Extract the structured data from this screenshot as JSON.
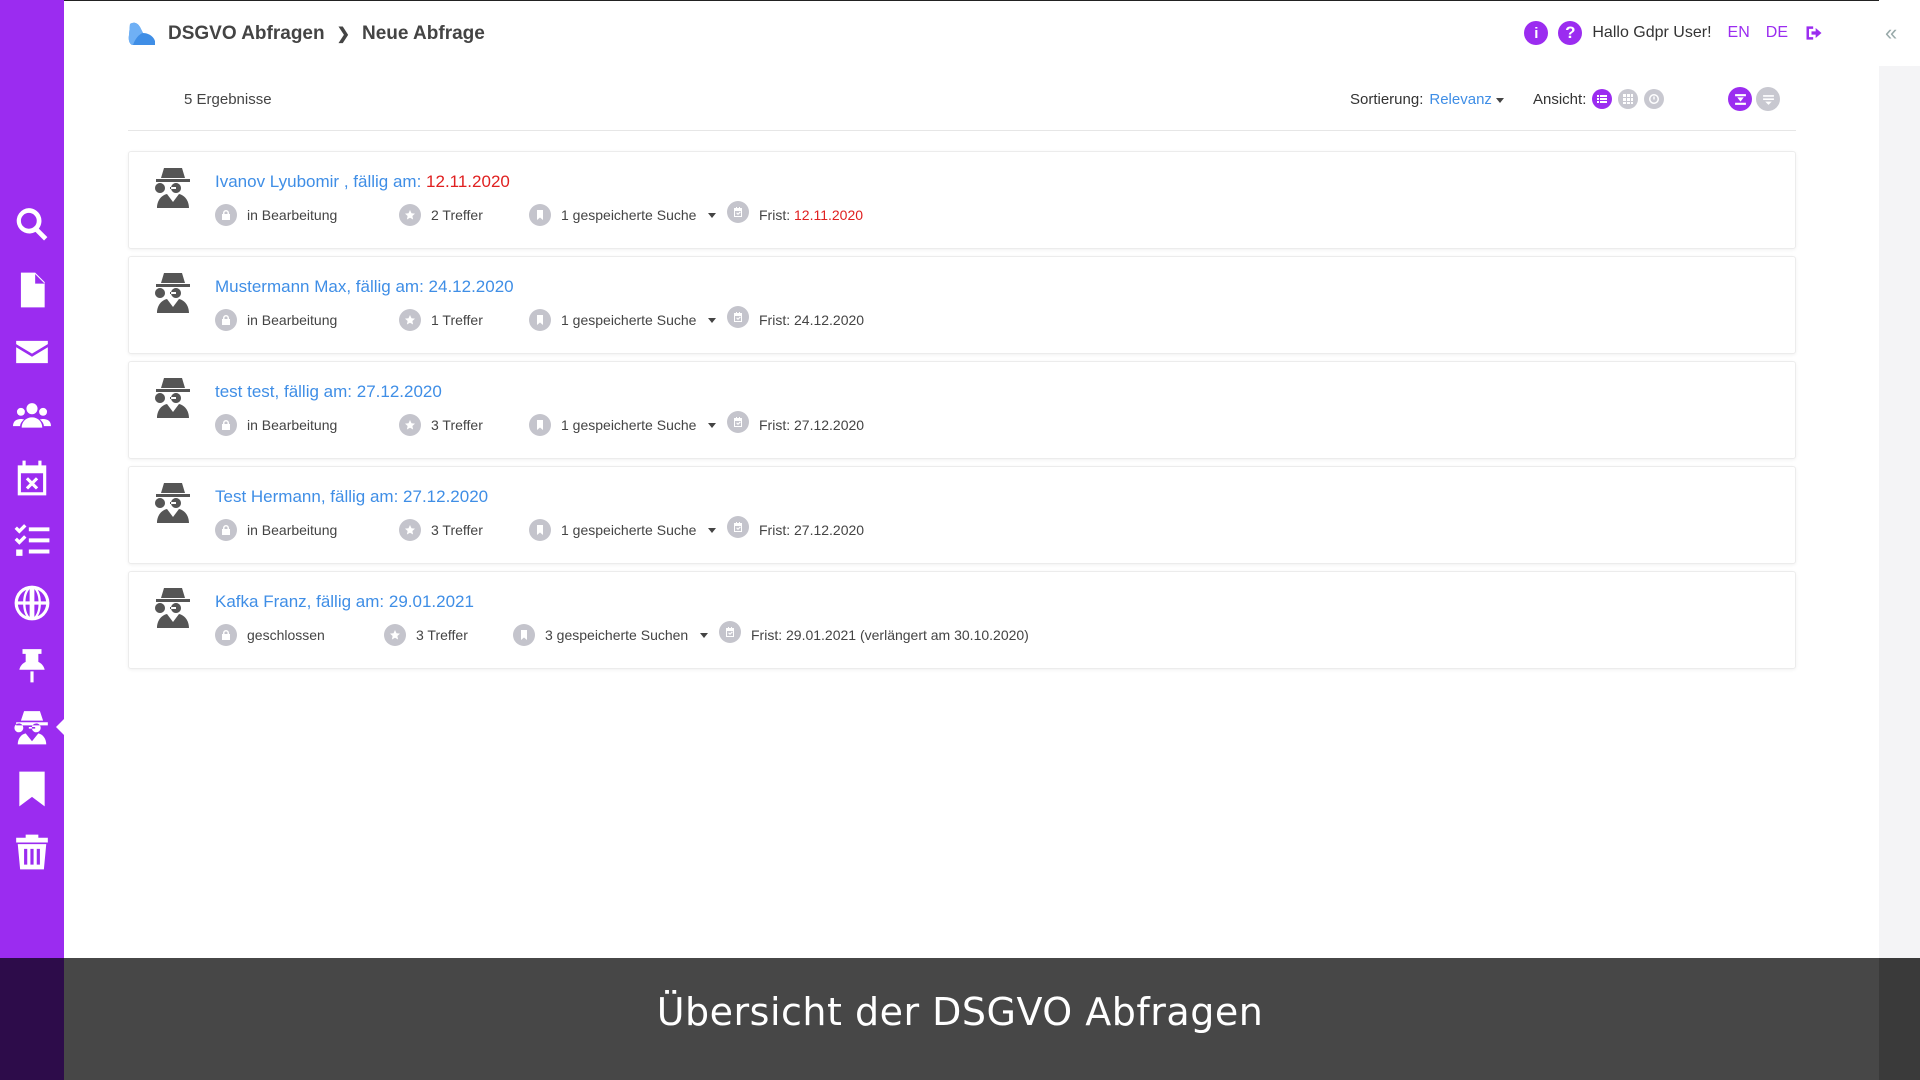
{
  "header": {
    "breadcrumb": [
      "DSGVO Abfragen",
      "Neue Abfrage"
    ],
    "info_icon": "info-icon",
    "help_icon": "help-icon",
    "greeting": "Hallo Gdpr User!",
    "lang_en": "EN",
    "lang_de": "DE",
    "logout_icon": "logout-icon",
    "collapse_icon": "«"
  },
  "sidebar": {
    "items": [
      {
        "icon": "search-icon"
      },
      {
        "icon": "document-icon"
      },
      {
        "icon": "mail-icon"
      },
      {
        "icon": "users-icon"
      },
      {
        "icon": "calendar-x-icon"
      },
      {
        "icon": "checklist-icon"
      },
      {
        "icon": "globe-icon"
      },
      {
        "icon": "pin-icon"
      },
      {
        "icon": "spy-icon",
        "active": true
      },
      {
        "icon": "bookmark-icon"
      },
      {
        "icon": "trash-icon"
      }
    ]
  },
  "toolbar": {
    "results_count": "5 Ergebnisse",
    "sort_label": "Sortierung:",
    "sort_value": "Relevanz",
    "view_label": "Ansicht:"
  },
  "requests": [
    {
      "title": "Ivanov Lyubomir , fällig am:",
      "due": "12.11.2020",
      "due_overdue": true,
      "status": "in Bearbeitung",
      "hits": "2 Treffer",
      "saved": "1 gespeicherte Suche",
      "deadline_label": "Frist:",
      "deadline": "12.11.2020",
      "deadline_extra": ""
    },
    {
      "title": "Mustermann Max, fällig am:",
      "due": "24.12.2020",
      "due_overdue": false,
      "status": "in Bearbeitung",
      "hits": "1 Treffer",
      "saved": "1 gespeicherte Suche",
      "deadline_label": "Frist:",
      "deadline": "24.12.2020",
      "deadline_extra": ""
    },
    {
      "title": "test test, fällig am:",
      "due": "27.12.2020",
      "due_overdue": false,
      "status": "in Bearbeitung",
      "hits": "3 Treffer",
      "saved": "1 gespeicherte Suche",
      "deadline_label": "Frist:",
      "deadline": "27.12.2020",
      "deadline_extra": ""
    },
    {
      "title": "Test Hermann, fällig am:",
      "due": "27.12.2020",
      "due_overdue": false,
      "status": "in Bearbeitung",
      "hits": "3 Treffer",
      "saved": "1 gespeicherte Suche",
      "deadline_label": "Frist:",
      "deadline": "27.12.2020",
      "deadline_extra": ""
    },
    {
      "title": "Kafka Franz, fällig am:",
      "due": "29.01.2021",
      "due_overdue": false,
      "status": "geschlossen",
      "hits": "3 Treffer",
      "saved": "3 gespeicherte Suchen",
      "deadline_label": "Frist:",
      "deadline": "29.01.2021",
      "deadline_extra": "(verlängert am 30.10.2020)"
    }
  ],
  "caption": "Übersicht der DSGVO Abfragen",
  "colors": {
    "accent": "#9b2cf0",
    "link": "#3f8ee6",
    "overdue": "#e02020",
    "caption_bg": "#474747"
  }
}
